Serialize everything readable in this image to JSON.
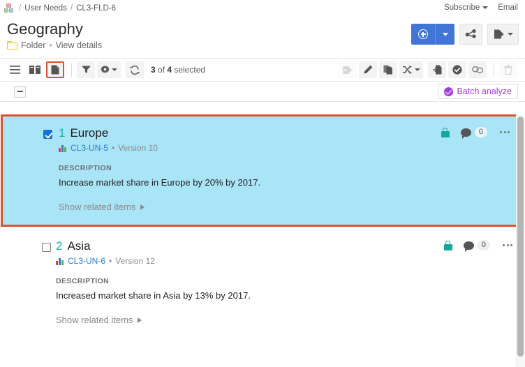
{
  "breadcrumb": {
    "icon": "org-icon",
    "items": [
      "User Needs",
      "CL3-FLD-6"
    ],
    "separator": "/"
  },
  "header": {
    "subscribe_label": "Subscribe",
    "email_label": "Email",
    "title": "Geography",
    "type_label": "Folder",
    "separator": "•",
    "view_details_label": "View details"
  },
  "top_actions": {
    "add_icon": "plus-circle-icon",
    "add_dropdown_icon": "caret-down-icon",
    "share_icon": "share-nodes-icon",
    "export_icon": "export-document-icon",
    "export_dropdown_icon": "caret-down-icon"
  },
  "toolbar": {
    "left": [
      {
        "name": "list-view-icon",
        "selected": false
      },
      {
        "name": "book-view-icon",
        "selected": false
      },
      {
        "name": "document-view-icon",
        "selected": true
      }
    ],
    "filter_icon": "filter-funnel-icon",
    "settings_icon": "gear-icon",
    "refresh_icon": "refresh-icon",
    "selection_count": "3",
    "selection_mid": " of ",
    "selection_total": "4",
    "selection_suffix": " selected",
    "right": [
      {
        "name": "tag-icon",
        "disabled": true
      },
      {
        "name": "edit-pencil-icon",
        "disabled": false
      },
      {
        "name": "duplicate-icon",
        "disabled": false
      },
      {
        "name": "shuffle-icon",
        "disabled": false
      },
      {
        "name": "move-to-icon",
        "disabled": false
      },
      {
        "name": "approve-check-icon",
        "disabled": false
      },
      {
        "name": "link-chain-icon",
        "disabled": false
      },
      {
        "name": "delete-trash-icon",
        "disabled": true
      }
    ]
  },
  "subbar": {
    "collapse_icon": "minus-icon",
    "batch_analyze_label": "Batch analyze",
    "batch_analyze_icon": "purple-check-badge-icon"
  },
  "colors": {
    "selected_card_background": "#a9e4f7",
    "selected_card_border": "#e1512a",
    "accent_blue": "#4176d7",
    "item_number_teal": "#16b5ae",
    "link_blue": "#2a7fd4",
    "batch_purple": "#a33ed6",
    "lock_teal": "#14a79a"
  },
  "items": [
    {
      "selected": true,
      "checked": true,
      "number": "1",
      "name": "Europe",
      "id": "CL3-UN-5",
      "separator": "•",
      "version": "Version 10",
      "lock_icon": "lock-icon",
      "comment_icon": "comment-bubble-icon",
      "comment_count": "0",
      "more_icon": "more-options-icon",
      "description_label": "DESCRIPTION",
      "description": "Increase market share in Europe by 20% by 2017.",
      "show_related_label": "Show related items",
      "show_related_icon": "triangle-right-icon"
    },
    {
      "selected": false,
      "checked": false,
      "number": "2",
      "name": "Asia",
      "id": "CL3-UN-6",
      "separator": "•",
      "version": "Version 12",
      "lock_icon": "lock-icon",
      "comment_icon": "comment-bubble-icon",
      "comment_count": "0",
      "more_icon": "more-options-icon",
      "description_label": "DESCRIPTION",
      "description": "Increased market share in Asia by 13% by 2017.",
      "show_related_label": "Show related items",
      "show_related_icon": "triangle-right-icon"
    }
  ]
}
